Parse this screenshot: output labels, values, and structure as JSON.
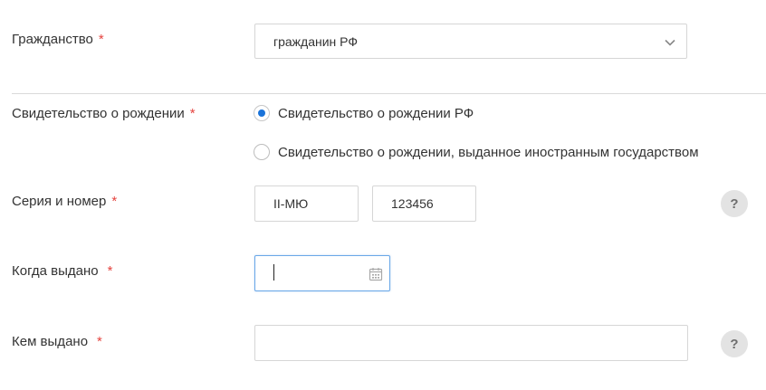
{
  "form": {
    "citizenship": {
      "label": "Гражданство",
      "required_mark": "*",
      "selected": "гражданин РФ",
      "chevron_icon": "chevron-down-icon"
    },
    "birth_certificate": {
      "label": "Свидетельство о рождении",
      "required_mark": "*",
      "options": [
        {
          "label": "Свидетельство о рождении РФ",
          "checked": true
        },
        {
          "label": "Свидетельство о рождении, выданное иностранным государством",
          "checked": false
        }
      ]
    },
    "series_number": {
      "label": "Серия и номер",
      "required_mark": "*",
      "series_value": "II-МЮ",
      "number_value": "123456",
      "help_text": "?"
    },
    "issue_date": {
      "label": "Когда выдано",
      "required_mark": "*",
      "value": "",
      "calendar_icon": "calendar-icon"
    },
    "issued_by": {
      "label": "Кем выдано",
      "required_mark": "*",
      "value": "",
      "help_text": "?"
    }
  },
  "colors": {
    "required": "#e5443f",
    "accent": "#1a73d9",
    "focus_border": "#6aa8e8",
    "border": "#d6d6d6",
    "help_bg": "#e3e3e3"
  }
}
